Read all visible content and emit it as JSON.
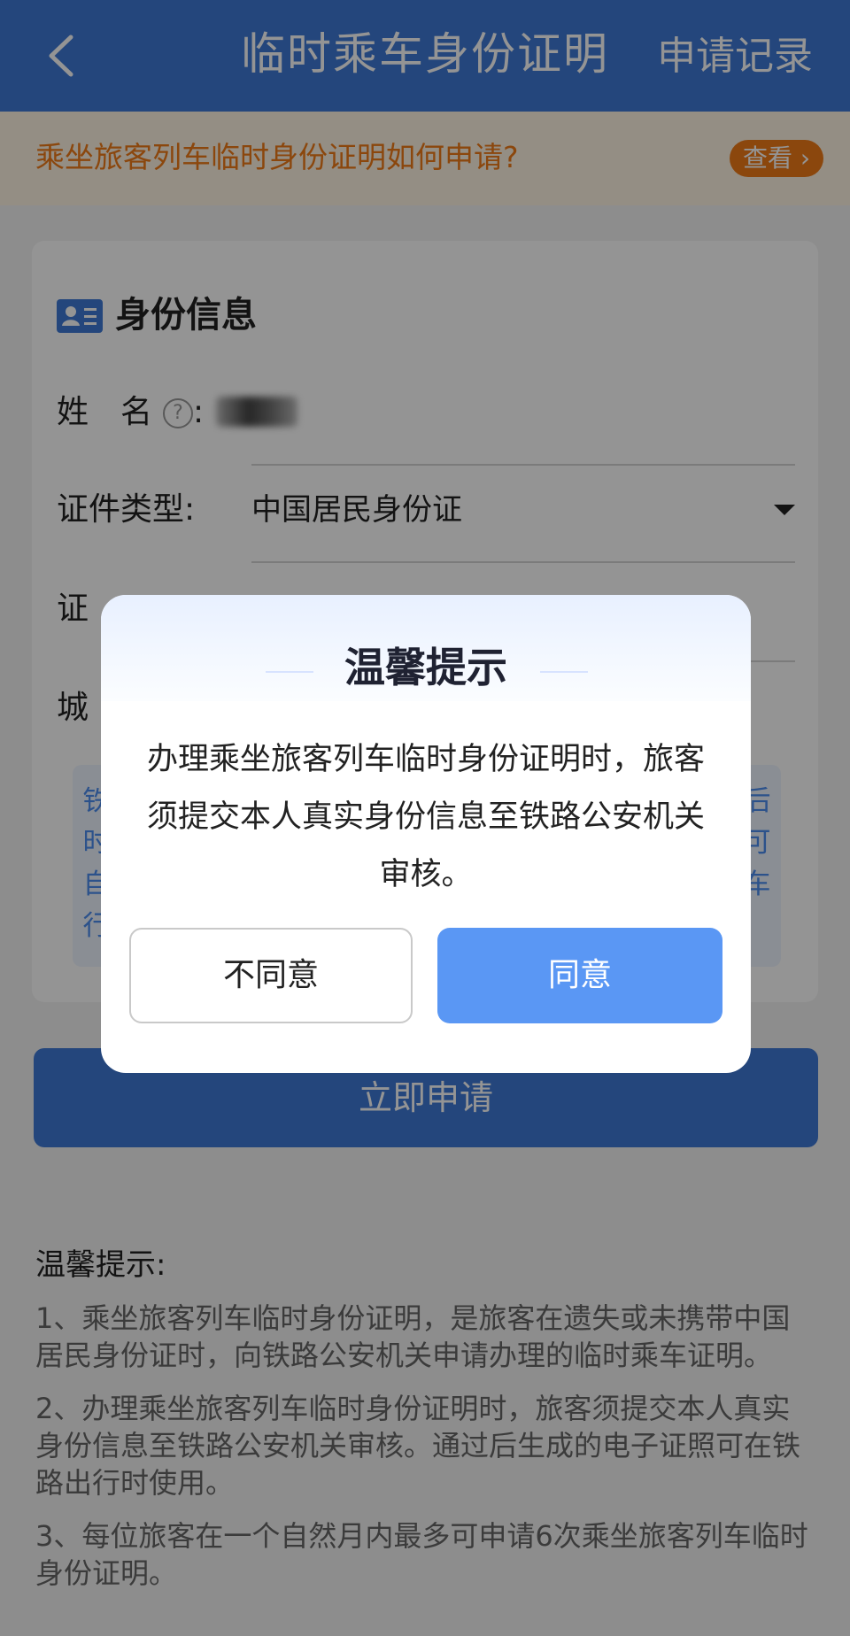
{
  "header": {
    "title": "临时乘车身份证明",
    "records_label": "申请记录"
  },
  "banner": {
    "text": "乘坐旅客列车临时身份证明如何申请?",
    "button_label": "查看 ›"
  },
  "form": {
    "section_title": "身份信息",
    "name_label": "姓　名",
    "help_icon": "?",
    "colon": ":",
    "id_type_label": "证件类型:",
    "id_type_value": "中国居民身份证",
    "id_number_label_visible": "证",
    "city_label_visible": "城",
    "notice_left_chars": [
      "铁",
      "时",
      "自",
      "行"
    ],
    "notice_right_chars": [
      "后",
      "可",
      "车"
    ]
  },
  "apply_button_label": "立即申请",
  "tips": {
    "title": "温馨提示:",
    "items": [
      "1、乘坐旅客列车临时身份证明，是旅客在遗失或未携带中国居民身份证时，向铁路公安机关申请办理的临时乘车证明。",
      "2、办理乘坐旅客列车临时身份证明时，旅客须提交本人真实身份信息至铁路公安机关审核。通过后生成的电子证照可在铁路出行时使用。",
      "3、每位旅客在一个自然月内最多可申请6次乘坐旅客列车临时身份证明。"
    ]
  },
  "dialog": {
    "title": "温馨提示",
    "body": "办理乘坐旅客列车临时身份证明时，旅客须提交本人真实身份信息至铁路公安机关审核。",
    "disagree_label": "不同意",
    "agree_label": "同意"
  }
}
